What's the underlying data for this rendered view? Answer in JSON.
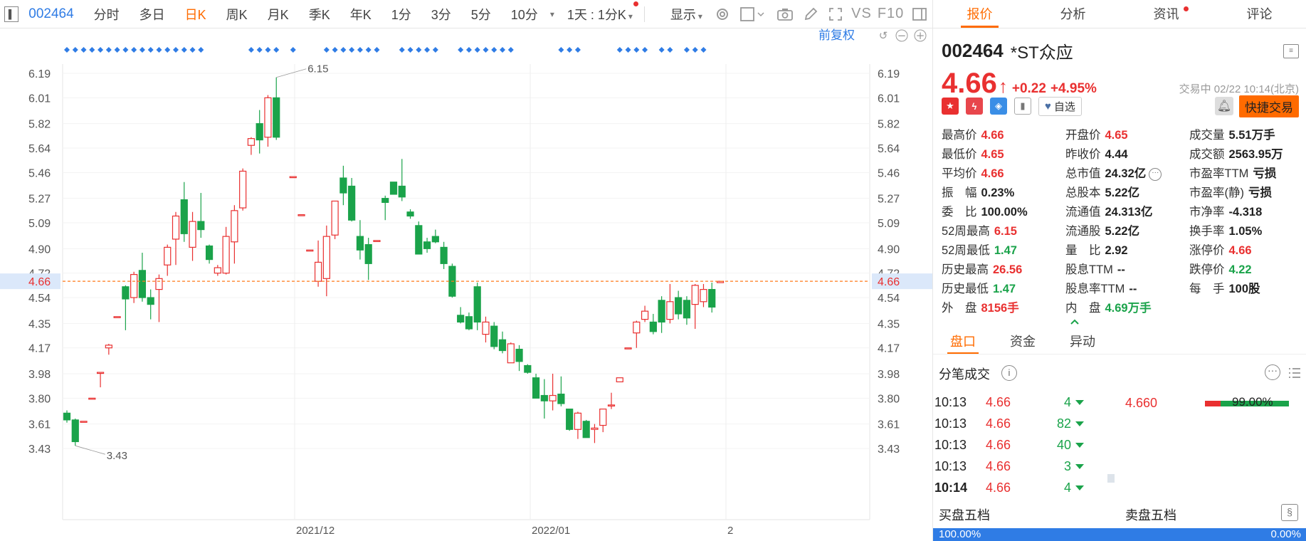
{
  "toolbar": {
    "code": "002464",
    "tabs": [
      "分时",
      "多日",
      "日K",
      "周K",
      "月K",
      "季K",
      "年K",
      "1分",
      "3分",
      "5分",
      "10分"
    ],
    "active_tab": "日K",
    "interval_select": "1天 : 1分K",
    "display_label": "显示",
    "vs_label": "VS",
    "f10_label": "F10"
  },
  "chart_header": {
    "adjust_label": "前复权"
  },
  "right_tabs": [
    "报价",
    "分析",
    "资讯",
    "评论"
  ],
  "quote": {
    "code": "002464",
    "name": "*ST众应",
    "price": "4.66",
    "change": "+0.22",
    "change_pct": "+4.95%",
    "trade_time": "交易中 02/22 10:14(北京)",
    "watch_label": "自选",
    "quick_trade_label": "快捷交易"
  },
  "stats": [
    {
      "label": "最高价",
      "value": "4.66",
      "color": "red"
    },
    {
      "label": "开盘价",
      "value": "4.65",
      "color": "red"
    },
    {
      "label": "成交量",
      "value": "5.51万手",
      "color": "dark"
    },
    {
      "label": "最低价",
      "value": "4.65",
      "color": "red"
    },
    {
      "label": "昨收价",
      "value": "4.44",
      "color": "dark"
    },
    {
      "label": "成交额",
      "value": "2563.95万",
      "color": "dark"
    },
    {
      "label": "平均价",
      "value": "4.66",
      "color": "red"
    },
    {
      "label": "总市值",
      "value": "24.32亿",
      "color": "dark"
    },
    {
      "label": "市盈率TTM",
      "value": "亏损",
      "color": "dark"
    },
    {
      "label": "振　幅",
      "value": "0.23%",
      "color": "dark"
    },
    {
      "label": "总股本",
      "value": "5.22亿",
      "color": "dark"
    },
    {
      "label": "市盈率(静)",
      "value": "亏损",
      "color": "dark"
    },
    {
      "label": "委　比",
      "value": "100.00%",
      "color": "dark"
    },
    {
      "label": "流通值",
      "value": "24.313亿",
      "color": "dark"
    },
    {
      "label": "市净率",
      "value": "-4.318",
      "color": "dark"
    },
    {
      "label": "52周最高",
      "value": "6.15",
      "color": "red"
    },
    {
      "label": "流通股",
      "value": "5.22亿",
      "color": "dark"
    },
    {
      "label": "换手率",
      "value": "1.05%",
      "color": "dark"
    },
    {
      "label": "52周最低",
      "value": "1.47",
      "color": "green"
    },
    {
      "label": "量　比",
      "value": "2.92",
      "color": "dark"
    },
    {
      "label": "涨停价",
      "value": "4.66",
      "color": "red"
    },
    {
      "label": "历史最高",
      "value": "26.56",
      "color": "red"
    },
    {
      "label": "股息TTM",
      "value": "--",
      "color": "dark"
    },
    {
      "label": "跌停价",
      "value": "4.22",
      "color": "green"
    },
    {
      "label": "历史最低",
      "value": "1.47",
      "color": "green"
    },
    {
      "label": "股息率TTM",
      "value": "--",
      "color": "dark"
    },
    {
      "label": "每　手",
      "value": "100股",
      "color": "dark"
    },
    {
      "label": "外　盘",
      "value": "8156手",
      "color": "red"
    },
    {
      "label": "内　盘",
      "value": "4.69万手",
      "color": "green"
    }
  ],
  "section_tabs": [
    "盘口",
    "资金",
    "异动"
  ],
  "ticks_title": "分笔成交",
  "ticks": [
    {
      "time": "10:13",
      "price": "4.66",
      "qty": "4"
    },
    {
      "time": "10:13",
      "price": "4.66",
      "qty": "82"
    },
    {
      "time": "10:13",
      "price": "4.66",
      "qty": "40"
    },
    {
      "time": "10:13",
      "price": "4.66",
      "qty": "3"
    },
    {
      "time": "10:14",
      "price": "4.66",
      "qty": "4"
    }
  ],
  "avg_trade_price": "4.660",
  "ratio_text": "99.00%",
  "buy_five_label": "买盘五档",
  "sell_five_label": "卖盘五档",
  "bottom_bar": {
    "left": "100.00%",
    "right": "0.00%"
  },
  "chart_data": {
    "type": "candlestick",
    "y_ticks": [
      6.19,
      6.01,
      5.82,
      5.64,
      5.46,
      5.27,
      5.09,
      4.9,
      4.72,
      4.54,
      4.35,
      4.17,
      3.98,
      3.8,
      3.61,
      3.43
    ],
    "ylim": [
      3.28,
      6.28
    ],
    "x_labels": [
      "2021/12",
      "2022/01",
      "2"
    ],
    "current_price": 4.66,
    "annotations": [
      {
        "label": "6.15"
      },
      {
        "label": "3.43"
      }
    ],
    "limit_up_colors": {
      "up": "#e93030",
      "down": "#1aa34a"
    },
    "candles": [
      [
        3.69,
        3.64,
        3.71,
        3.62
      ],
      [
        3.64,
        3.48,
        3.65,
        3.45
      ],
      [
        3.63,
        3.63,
        3.63,
        3.63
      ],
      [
        3.8,
        3.8,
        3.8,
        3.8
      ],
      [
        3.99,
        3.99,
        3.99,
        3.88
      ],
      [
        4.17,
        4.19,
        4.2,
        4.12
      ],
      [
        4.4,
        4.4,
        4.4,
        4.4
      ],
      [
        4.62,
        4.53,
        4.63,
        4.3
      ],
      [
        4.54,
        4.71,
        4.73,
        4.5
      ],
      [
        4.74,
        4.54,
        4.87,
        4.51
      ],
      [
        4.54,
        4.49,
        4.6,
        4.38
      ],
      [
        4.6,
        4.68,
        4.71,
        4.36
      ],
      [
        4.78,
        4.91,
        4.93,
        4.7
      ],
      [
        4.97,
        5.14,
        5.17,
        4.78
      ],
      [
        5.26,
        5.01,
        5.39,
        4.95
      ],
      [
        4.91,
        5.1,
        5.17,
        4.81
      ],
      [
        5.1,
        5.04,
        5.31,
        4.98
      ],
      [
        4.92,
        4.82,
        4.93,
        4.79
      ],
      [
        4.72,
        4.76,
        4.78,
        4.7
      ],
      [
        4.72,
        4.99,
        5.06,
        4.71
      ],
      [
        4.95,
        5.18,
        5.22,
        4.79
      ],
      [
        5.2,
        5.47,
        5.49,
        5.18
      ],
      [
        5.66,
        5.71,
        5.72,
        5.59
      ],
      [
        5.82,
        5.7,
        5.92,
        5.6
      ],
      [
        5.72,
        6.01,
        6.03,
        5.65
      ],
      [
        6.01,
        5.72,
        6.16,
        5.7
      ],
      [
        null,
        null,
        null,
        null
      ],
      [
        5.43,
        5.43,
        5.43,
        5.43
      ],
      [
        5.15,
        5.15,
        5.15,
        5.15
      ],
      [
        4.89,
        4.89,
        4.89,
        4.89
      ],
      [
        4.66,
        4.8,
        4.96,
        4.62
      ],
      [
        4.68,
        4.99,
        5.07,
        4.55
      ],
      [
        5.0,
        5.25,
        5.25,
        4.97
      ],
      [
        5.42,
        5.31,
        5.51,
        5.22
      ],
      [
        5.36,
        5.11,
        5.42,
        5.1
      ],
      [
        4.99,
        4.89,
        5.11,
        4.82
      ],
      [
        4.93,
        4.79,
        4.98,
        4.67
      ],
      [
        4.96,
        4.96,
        4.96,
        4.96
      ],
      [
        5.27,
        5.24,
        5.29,
        5.11
      ],
      [
        5.39,
        5.3,
        5.39,
        5.3
      ],
      [
        5.36,
        5.28,
        5.56,
        5.25
      ],
      [
        5.17,
        5.14,
        5.19,
        5.12
      ],
      [
        5.07,
        4.86,
        5.1,
        4.86
      ],
      [
        4.95,
        4.9,
        4.98,
        4.87
      ],
      [
        4.99,
        4.95,
        5.04,
        4.94
      ],
      [
        4.91,
        4.79,
        4.95,
        4.75
      ],
      [
        4.77,
        4.55,
        4.79,
        4.54
      ],
      [
        4.41,
        4.36,
        4.47,
        4.35
      ],
      [
        4.4,
        4.31,
        4.43,
        4.3
      ],
      [
        4.62,
        4.36,
        4.65,
        4.3
      ],
      [
        4.27,
        4.36,
        4.4,
        4.21
      ],
      [
        4.33,
        4.18,
        4.36,
        4.16
      ],
      [
        4.23,
        4.15,
        4.29,
        4.13
      ],
      [
        4.06,
        4.2,
        4.21,
        4.06
      ],
      [
        4.16,
        4.07,
        4.19,
        4.0
      ],
      [
        4.04,
        3.99,
        4.05,
        3.98
      ],
      [
        3.95,
        3.8,
        3.98,
        3.8
      ],
      [
        3.82,
        3.78,
        3.94,
        3.65
      ],
      [
        3.78,
        3.82,
        3.98,
        3.71
      ],
      [
        3.83,
        3.76,
        3.96,
        3.74
      ],
      [
        3.72,
        3.57,
        3.72,
        3.56
      ],
      [
        3.57,
        3.69,
        3.7,
        3.5
      ],
      [
        3.63,
        3.51,
        3.64,
        3.51
      ],
      [
        3.57,
        3.58,
        3.61,
        3.47
      ],
      [
        3.6,
        3.72,
        3.72,
        3.55
      ],
      [
        3.75,
        3.75,
        3.84,
        3.72
      ],
      [
        3.92,
        3.95,
        3.95,
        3.92
      ],
      [
        4.17,
        4.17,
        4.17,
        4.17
      ],
      [
        4.28,
        4.36,
        4.37,
        4.17
      ],
      [
        4.38,
        4.44,
        4.48,
        4.36
      ],
      [
        4.36,
        4.29,
        4.42,
        4.27
      ],
      [
        4.52,
        4.36,
        4.55,
        4.28
      ],
      [
        4.38,
        4.51,
        4.64,
        4.35
      ],
      [
        4.54,
        4.42,
        4.59,
        4.38
      ],
      [
        4.52,
        4.39,
        4.55,
        4.34
      ],
      [
        4.49,
        4.63,
        4.64,
        4.31
      ],
      [
        4.51,
        4.6,
        4.64,
        4.47
      ],
      [
        4.6,
        4.47,
        4.65,
        4.43
      ],
      [
        4.65,
        4.66,
        4.66,
        4.65
      ]
    ]
  }
}
